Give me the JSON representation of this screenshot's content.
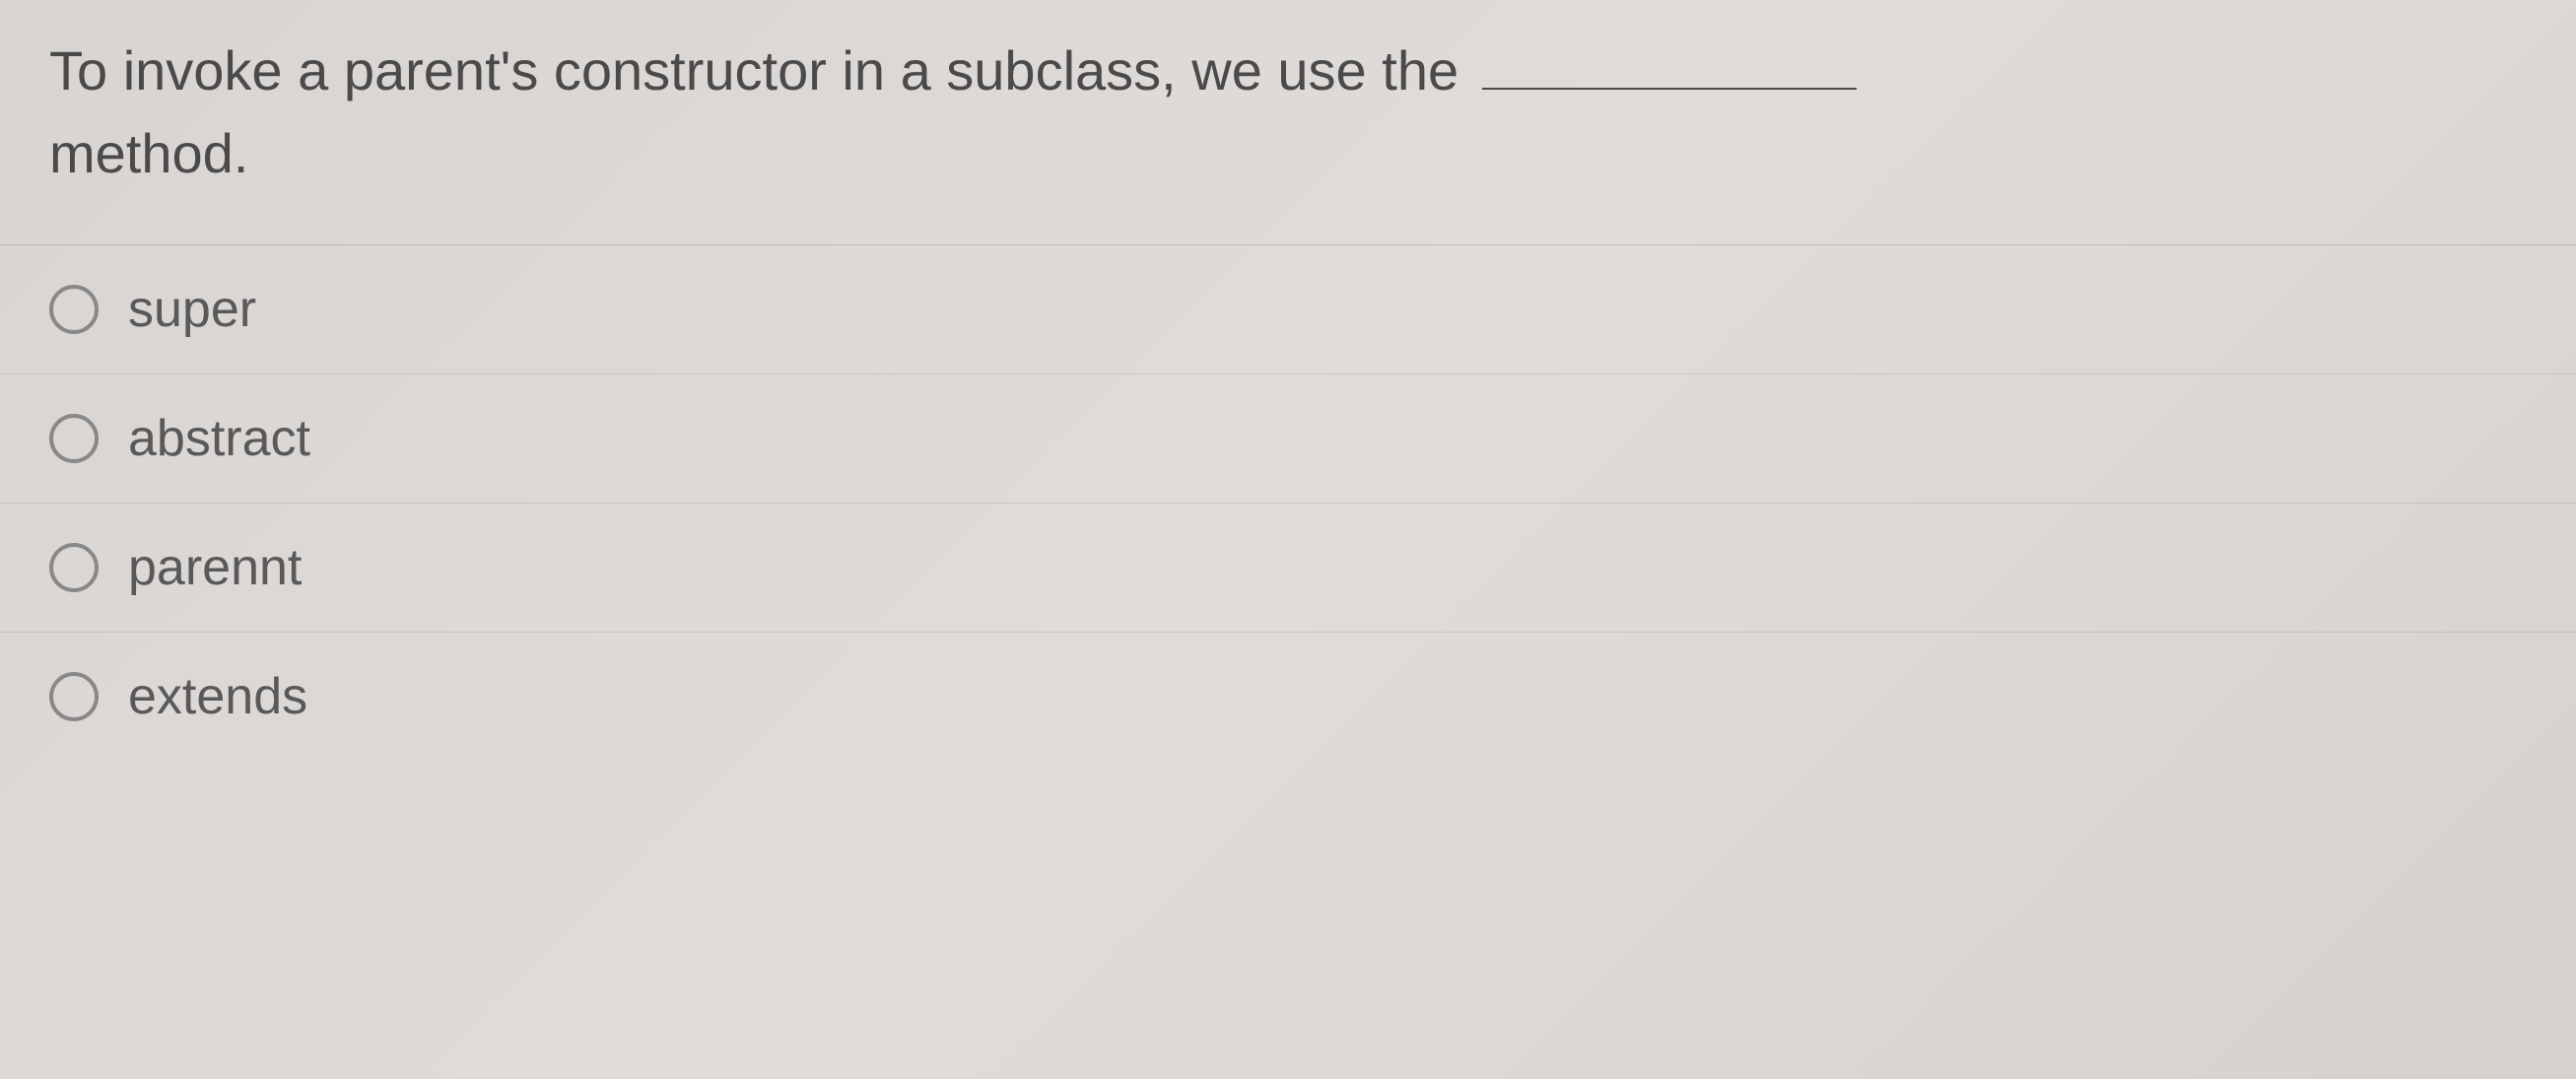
{
  "question": {
    "part1": "To invoke a parent's constructor in a subclass, we use the",
    "part2": "method."
  },
  "options": [
    {
      "label": "super"
    },
    {
      "label": "abstract"
    },
    {
      "label": "parennt"
    },
    {
      "label": "extends"
    }
  ]
}
